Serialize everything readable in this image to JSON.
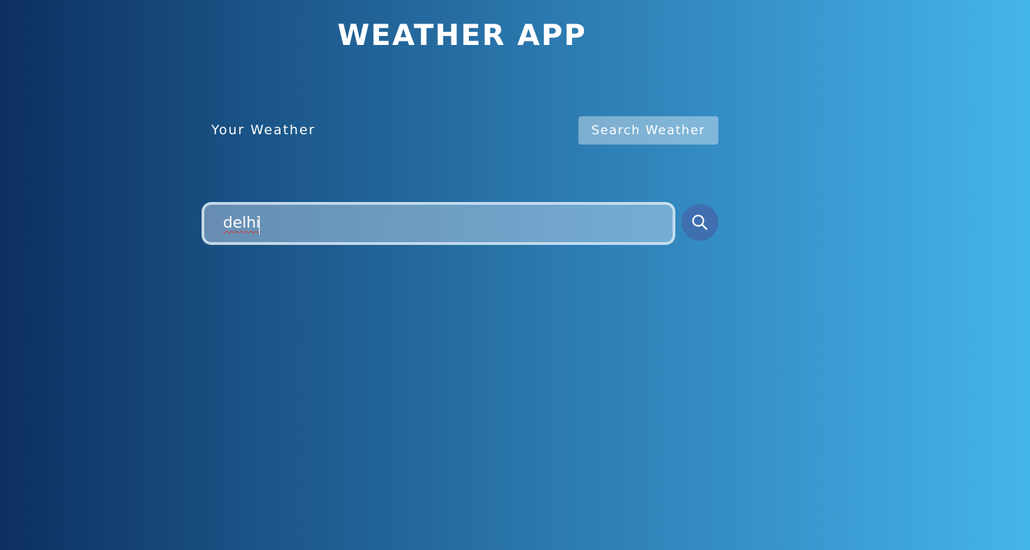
{
  "app": {
    "title": "WEATHER APP"
  },
  "tabs": {
    "your_weather": "Your Weather",
    "search_weather": "Search Weather"
  },
  "search": {
    "value": "delhi",
    "button_icon": "search-icon"
  },
  "colors": {
    "gradient_start": "#0d2f61",
    "gradient_end": "#44b5ea",
    "search_button": "#3f6fb0",
    "text": "#ffffff"
  }
}
